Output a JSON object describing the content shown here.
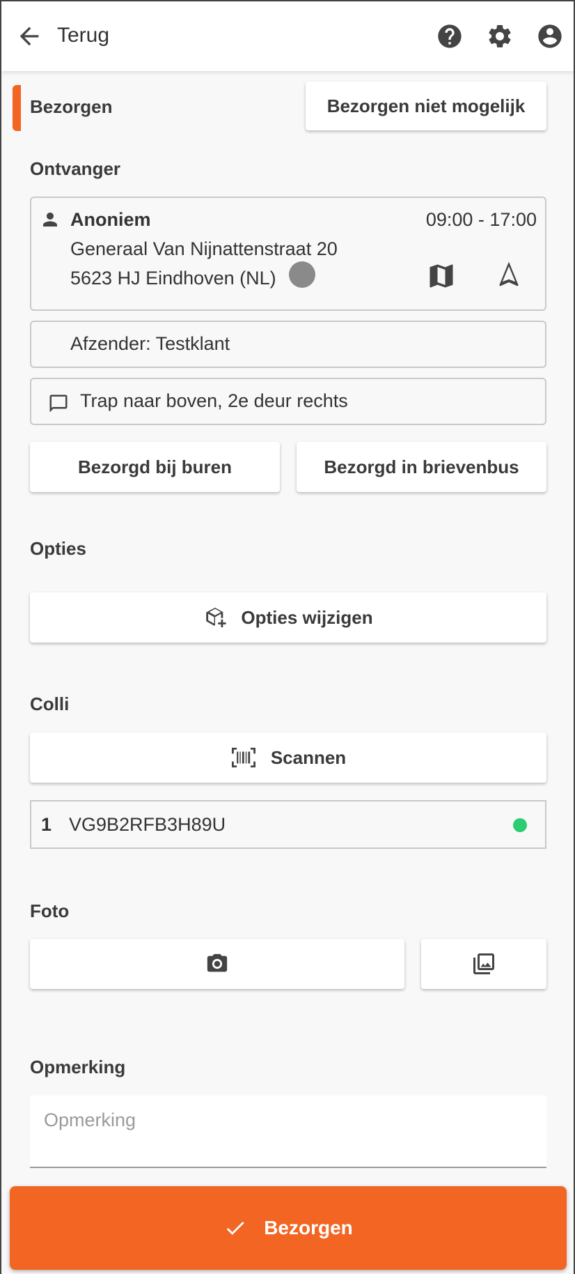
{
  "header": {
    "back_label": "Terug",
    "icons": [
      "arrow-left-icon",
      "help-icon",
      "gear-icon",
      "account-icon"
    ]
  },
  "delivery": {
    "section_label": "Bezorgen",
    "not_possible_label": "Bezorgen niet mogelijk"
  },
  "recipient": {
    "section_label": "Ontvanger",
    "name": "Anoniem",
    "time_window": "09:00 - 17:00",
    "address_line1": "Generaal Van Nijnattenstraat 20",
    "address_line2": "5623 HJ Eindhoven (NL)",
    "sender": "Afzender: Testklant",
    "note": "Trap naar boven, 2e deur rechts",
    "neighbours_label": "Bezorgd bij buren",
    "mailbox_label": "Bezorgd in brievenbus"
  },
  "options": {
    "section_label": "Opties",
    "change_label": "Opties wijzigen"
  },
  "colli": {
    "section_label": "Colli",
    "scan_label": "Scannen",
    "items": [
      {
        "index": "1",
        "code": "VG9B2RFB3H89U",
        "status_color": "#2ecc71"
      }
    ]
  },
  "photo": {
    "section_label": "Foto"
  },
  "remark": {
    "section_label": "Opmerking",
    "placeholder": "Opmerking",
    "value": ""
  },
  "submit": {
    "label": "Bezorgen"
  },
  "colors": {
    "accent": "#f26522",
    "status_ok": "#2ecc71"
  }
}
